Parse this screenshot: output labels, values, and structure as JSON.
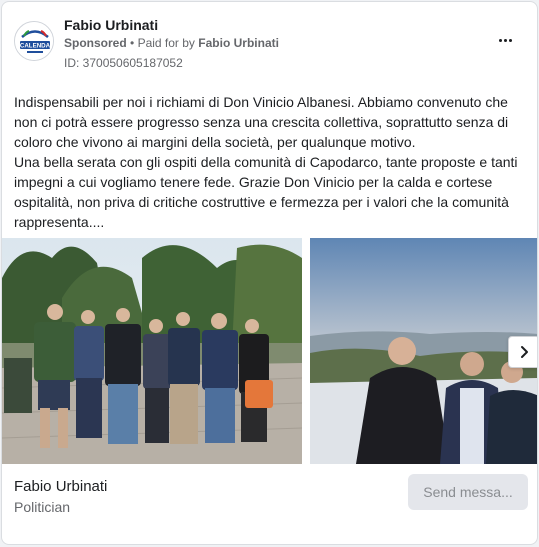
{
  "header": {
    "page_name": "Fabio Urbinati",
    "sponsored_label": "Sponsored",
    "separator": "•",
    "paid_for_prefix": "Paid for by",
    "paid_for_name": "Fabio Urbinati",
    "library_id": "ID: 370050605187052",
    "more_icon": "more-horizontal-icon",
    "avatar_logo_text": "CALENDA"
  },
  "post": {
    "text": "Indispensabili per noi i richiami di Don Vinicio Albanesi. Abbiamo convenuto che non ci potrà essere progresso senza una crescita collettiva, soprattutto senza di coloro che vivono ai margini della società, per qualunque motivo.\nUna bella serata con gli ospiti della comunità di Capodarco, tante proposte e tanti impegni a cui vogliamo tenere fede. Grazie Don Vinicio per la calda e cortese ospitalità, non priva di critiche costruttive e fermezza per i valori che la comunità rappresenta...."
  },
  "carousel": {
    "next_icon": "chevron-right-icon"
  },
  "footer": {
    "name": "Fabio Urbinati",
    "category": "Politician",
    "send_button_label": "Send messa..."
  },
  "colors": {
    "text_primary": "#1c1e21",
    "text_secondary": "#65676b",
    "button_bg": "#e4e6eb",
    "logo_blue": "#1f4e9c",
    "logo_red": "#d52b2b",
    "logo_green": "#2e9a3f"
  }
}
